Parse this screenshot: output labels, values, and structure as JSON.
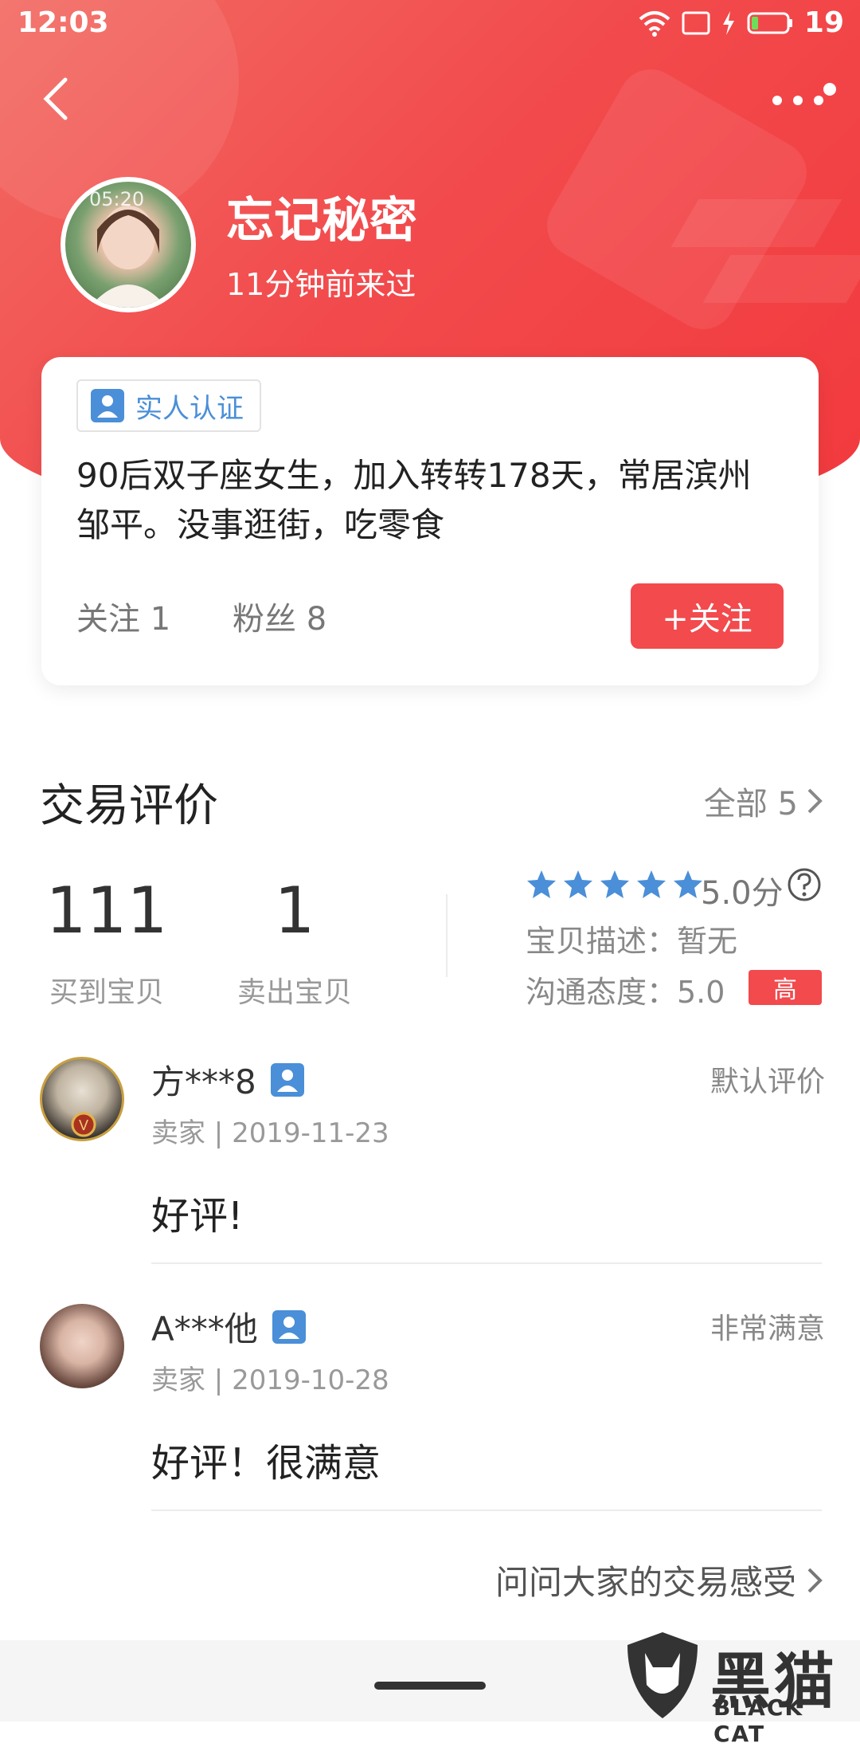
{
  "status_bar": {
    "time": "12:03",
    "battery": "19"
  },
  "profile": {
    "name": "忘记秘密",
    "last_visit": "11分钟前来过",
    "avatar_overlay": "05:20",
    "verify_label": "实人认证",
    "bio": "90后双子座女生，加入转转178天，常居滨州 邹平。没事逛街，吃零食",
    "following": "关注 1",
    "followers": "粉丝 8",
    "follow_button": "+关注"
  },
  "reviews_section": {
    "title": "交易评价",
    "see_all": "全部 5",
    "bought_count": "111",
    "bought_label": "买到宝贝",
    "sold_count": "1",
    "sold_label": "卖出宝贝",
    "stars": 5,
    "score": "5.0分",
    "desc_label": "宝贝描述：暂无",
    "comm_label": "沟通态度：5.0",
    "comm_level": "高",
    "star_color": "#4a8fd8",
    "accent_color": "#f24a4d"
  },
  "reviews": [
    {
      "name": "方***8",
      "meta": "卖家 | 2019-11-23",
      "tag": "默认评价",
      "text": "好评!"
    },
    {
      "name": "A***他",
      "meta": "卖家 | 2019-10-28",
      "tag": "非常满意",
      "text": "好评！很满意"
    }
  ],
  "ask_link": "问问大家的交易感受",
  "watermark": {
    "main": "黑猫",
    "sub": "BLACK CAT"
  }
}
